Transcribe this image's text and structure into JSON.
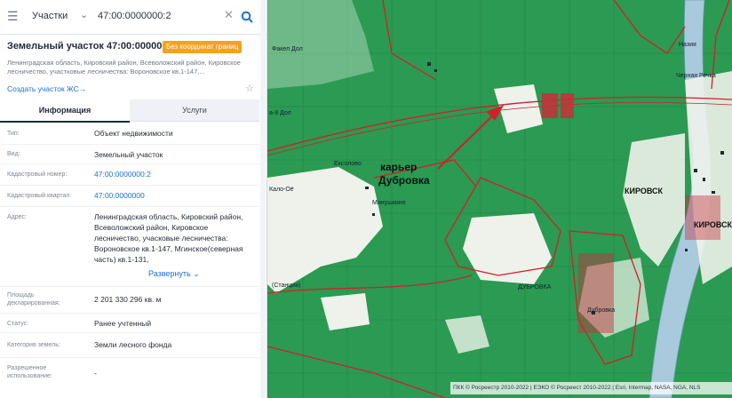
{
  "search": {
    "type_label": "Участки",
    "value": "47:00:0000000:2"
  },
  "parcel": {
    "title": "Земельный участок 47:00:0000000:2",
    "badge": "Без координат границ",
    "address_short_1": "Ленинградская область, Кировский район, Всеволожский район, Кировское",
    "address_short_2": "лесничество, участковые лесничества: Вороновское кв.1-147,...",
    "create_link": "Создать участок ЖС→"
  },
  "tabs": {
    "info": "Информация",
    "services": "Услуги"
  },
  "details": [
    {
      "label": "Тип:",
      "value": "Объект недвижимости"
    },
    {
      "label": "Вид:",
      "value": "Земельный участок"
    },
    {
      "label": "Кадастровый номер:",
      "value": "47:00:0000000:2"
    },
    {
      "label": "Кадастровый квартал:",
      "value": "47:00:0000000"
    },
    {
      "label": "Адрес:",
      "value": "Ленинградская область, Кировский район, Всеволожский район, Кировское лесничество, учасковые лесничества: Вороновское кв.1-147, Мгинское(северная часть) кв.1-131,"
    },
    {
      "label": "Площадь декларированная:",
      "value": "2 201 330 296 кв. м"
    },
    {
      "label": "Статус:",
      "value": "Ранее учтенный"
    },
    {
      "label": "Категория земель:",
      "value": "Земли лесного фонда"
    },
    {
      "label": "Разрешенное использование:",
      "value": "-"
    }
  ],
  "expand_label": "Развернуть ⌄",
  "map": {
    "annotation_line1": "карьер",
    "annotation_line2": "Дубровка",
    "places": [
      "Факел Дол",
      "Назия",
      "Черная Речка",
      "Ексолово",
      "Кало-Оё",
      "Манушкино",
      "КИРОВСК",
      "КИРОВСК",
      "Дубровка",
      "ДУБРОВКА",
      "(Станция)",
      "а-8 Дол"
    ],
    "attribution": "ПКК © Росреестр 2010-2022 | ЕЭКО © Росреест 2010-2022 | Esri, Intermap, NASA, NGA, NLS"
  },
  "colors": {
    "forest": "#2b9a52",
    "parcel_border": "#d21f2a",
    "link": "#1d6fd3",
    "badge": "#f3a21f"
  }
}
